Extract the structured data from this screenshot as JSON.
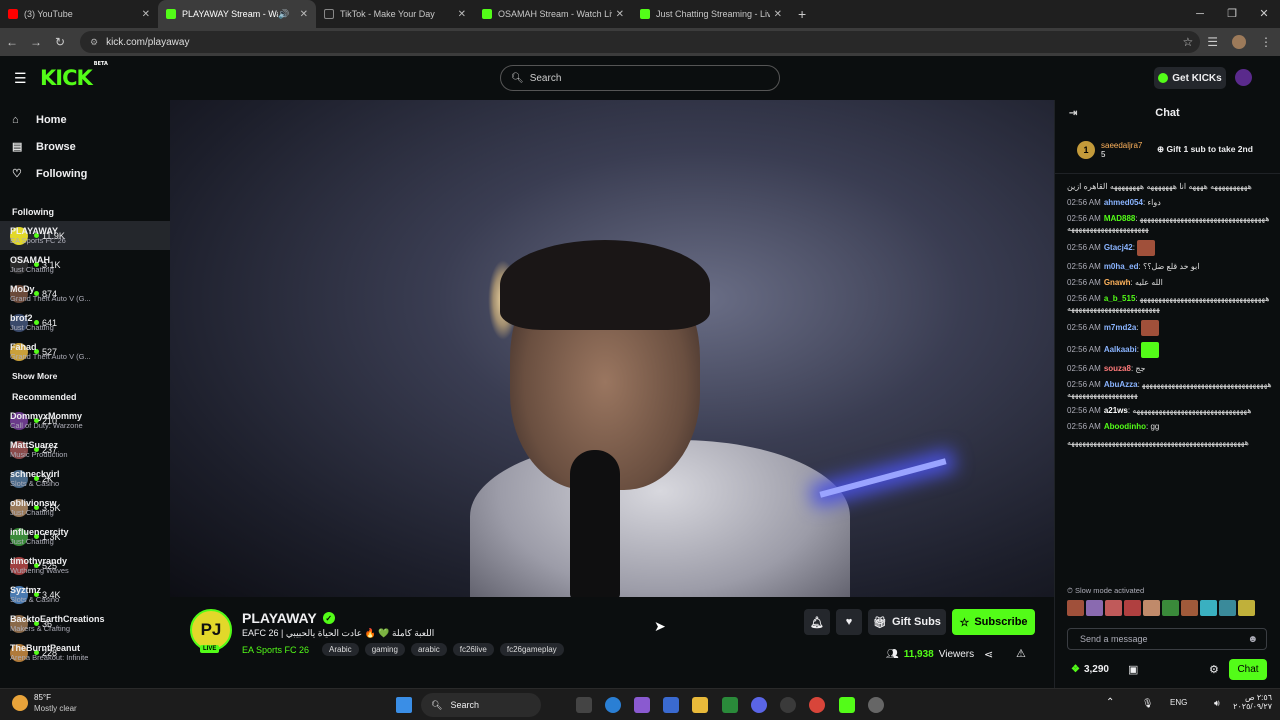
{
  "browser": {
    "tabs": [
      {
        "title": "(3) YouTube",
        "color": "#ff0000",
        "active": false
      },
      {
        "title": "PLAYAWAY Stream - Watch",
        "color": "#53fc18",
        "active": true
      },
      {
        "title": "TikTok - Make Your Day",
        "color": "#222222",
        "active": false
      },
      {
        "title": "OSAMAH Stream - Watch Live",
        "color": "#53fc18",
        "active": false
      },
      {
        "title": "Just Chatting Streaming - Live",
        "color": "#53fc18",
        "active": false
      }
    ],
    "url": "kick.com/playaway"
  },
  "header": {
    "logo": "KICK",
    "logo_beta": "BETA",
    "search_placeholder": "Search",
    "get_kicks": "Get KICKs",
    "accent": "#53fc18"
  },
  "sidebar": {
    "nav": [
      {
        "label": "Home",
        "icon": "home-icon"
      },
      {
        "label": "Browse",
        "icon": "browse-icon"
      },
      {
        "label": "Following",
        "icon": "heart-icon"
      }
    ],
    "following_title": "Following",
    "following": [
      {
        "name": "PLAYAWAY",
        "game": "EA Sports FC 26",
        "viewers": "11.9K",
        "color": "#e2d82a"
      },
      {
        "name": "OSAMAH",
        "game": "Just Chatting",
        "viewers": "3.1K",
        "color": "#2a2a2a"
      },
      {
        "name": "MoDy",
        "game": "Grand Theft Auto V (G...",
        "viewers": "874",
        "color": "#6b4a3a"
      },
      {
        "name": "brof2",
        "game": "Just Chatting",
        "viewers": "641",
        "color": "#3a4a6b"
      },
      {
        "name": "Fahad",
        "game": "Grand Theft Auto V (G...",
        "viewers": "527",
        "color": "#c9a03a"
      }
    ],
    "show_more": "Show More",
    "recommended_title": "Recommended",
    "recommended": [
      {
        "name": "DommyxMommy",
        "game": "Call of Duty: Warzone",
        "viewers": "210",
        "color": "#6a3a8a"
      },
      {
        "name": "MattSuarez",
        "game": "Music Production",
        "viewers": "237",
        "color": "#8a4a4a"
      },
      {
        "name": "schneckyirl",
        "game": "Slots & Casino",
        "viewers": "2K",
        "color": "#4a6a8a"
      },
      {
        "name": "oblivionsw",
        "game": "Just Chatting",
        "viewers": "3.5K",
        "color": "#9a7a5a"
      },
      {
        "name": "influencercity",
        "game": "Just Chatting",
        "viewers": "1.3K",
        "color": "#3a8a3a"
      },
      {
        "name": "timothyrandy",
        "game": "Wuthering Waves",
        "viewers": "525",
        "color": "#a04040"
      },
      {
        "name": "Syztmz",
        "game": "Slots & Casino",
        "viewers": "3.4K",
        "color": "#4a7ab0"
      },
      {
        "name": "BacktoEarthCreations",
        "game": "Makers & Crafting",
        "viewers": "36",
        "color": "#8a6a4a"
      },
      {
        "name": "TheBurntPeanut",
        "game": "Arena Breakout: Infinite",
        "viewers": "228",
        "color": "#b07a3a"
      }
    ]
  },
  "stream": {
    "name": "PLAYAWAY",
    "initials": "PJ",
    "live": "LIVE",
    "title": "EAFC 26 | اللعبة كاملة 💚 🔥 عادت الحياة يالحبيبي",
    "category": "EA Sports FC 26",
    "tags": [
      "Arabic",
      "gaming",
      "arabic",
      "fc26live",
      "fc26gameplay"
    ],
    "gift_subs": "Gift Subs",
    "subscribe": "Subscribe",
    "viewers": "11,938",
    "viewers_label": "Viewers"
  },
  "chat": {
    "title": "Chat",
    "pinned_rank": "1",
    "pinned_user": "saeedaljra7",
    "pinned_count": "5",
    "pinned_gift": "Gift 1 sub to take 2nd",
    "messages": [
      {
        "time": "",
        "user": "",
        "color": "#ffffff",
        "text": "ههههههههههه ههههه انا هههههههه ههههههههه القاهره ازين"
      },
      {
        "time": "02:56 AM",
        "user": "ahmed054",
        "color": "#8ab4ff",
        "text": "دواء"
      },
      {
        "time": "02:56 AM",
        "user": "MAD888",
        "color": "#53fc18",
        "text": "ههههههههههههههههههههههههههههههههههههههههههههههههههههههههه"
      },
      {
        "time": "02:56 AM",
        "user": "Gtacj42",
        "color": "#8ab4ff",
        "text": ""
      },
      {
        "time": "02:56 AM",
        "user": "m0ha_ed",
        "color": "#8ab4ff",
        "text": "ابو خد قلع ضل؟؟"
      },
      {
        "time": "02:56 AM",
        "user": "Gnawh",
        "color": "#ffb35c",
        "text": "الله عليه"
      },
      {
        "time": "02:56 AM",
        "user": "a_b_515",
        "color": "#53fc18",
        "text": "هههههههههههههههههههههههههههههههههههههههههههههههههههههههههههه"
      },
      {
        "time": "02:56 AM",
        "user": "m7md2a",
        "color": "#8ab4ff",
        "text": ""
      },
      {
        "time": "02:56 AM",
        "user": "Aalkaabi",
        "color": "#8ab4ff",
        "text": ""
      },
      {
        "time": "02:56 AM",
        "user": "souza8",
        "color": "#ff7a7a",
        "text": "جج"
      },
      {
        "time": "02:56 AM",
        "user": "AbuAzza",
        "color": "#8ab4ff",
        "text": "هههههههههههههههههههههههههههههههههههههههههههههههههههههه"
      },
      {
        "time": "02:56 AM",
        "user": "a21ws",
        "color": "#ffffff",
        "text": "هههههههههههههههههههههههههههههههه"
      },
      {
        "time": "02:56 AM",
        "user": "Aboodinho",
        "color": "#53fc18",
        "text": "gg"
      },
      {
        "time": "",
        "user": "",
        "color": "#ffffff",
        "text": "ههههههههههههههههههههههههههههههههههههههههههههههههه"
      }
    ],
    "slow_mode": "Slow mode activated",
    "send_placeholder": "Send a message",
    "points": "3,290",
    "chat_button": "Chat"
  },
  "taskbar": {
    "weather_temp": "85°F",
    "weather_desc": "Mostly clear",
    "search": "Search",
    "lang": "ENG",
    "time": "٢:٥٦ ص",
    "date": "٢٠٢٥/٠٩/٢٧"
  }
}
